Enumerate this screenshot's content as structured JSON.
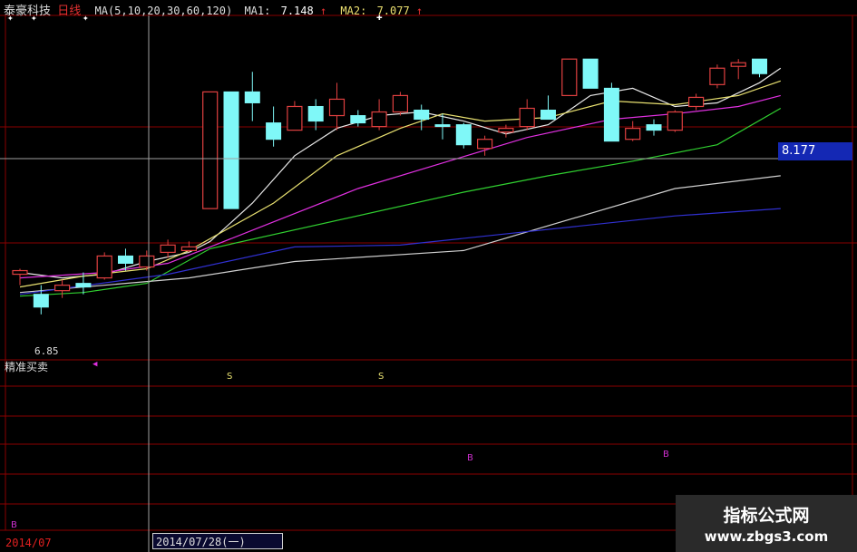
{
  "header": {
    "stock_name": "泰豪科技",
    "period": "日线",
    "ma_params": "MA(5,10,20,30,60,120)",
    "ma1_label": "MA1:",
    "ma1_value": "7.148",
    "ma1_arrow": "↑",
    "ma2_label": "MA2:",
    "ma2_value": "7.077",
    "ma2_arrow": "↑"
  },
  "current_price": "8.177",
  "low_price_label": "6.85",
  "indicator_panel": {
    "title": "精准买卖",
    "sell_label": "S",
    "buy_label": "B"
  },
  "footer": {
    "start_date": "2014/07",
    "cursor_date": "2014/07/28(一)"
  },
  "watermark": {
    "line1": "指标公式网",
    "line2": "www.zbgs3.com"
  },
  "colors": {
    "up_candle": "#e04040",
    "down_candle": "#7ff8f8",
    "ma5": "#e8e8e8",
    "ma10": "#e8e070",
    "ma20": "#e030e0",
    "ma30": "#30d030",
    "ma60": "#d0d0d0",
    "ma120": "#3030d0",
    "grid": "#8a0000"
  },
  "chart_data": {
    "type": "candlestick",
    "ylim": [
      6.7,
      8.4
    ],
    "candles": [
      {
        "o": 7.07,
        "h": 7.1,
        "l": 7.01,
        "c": 7.09
      },
      {
        "o": 6.96,
        "h": 7.01,
        "l": 6.85,
        "c": 6.89
      },
      {
        "o": 6.98,
        "h": 7.04,
        "l": 6.94,
        "c": 7.01
      },
      {
        "o": 7.02,
        "h": 7.08,
        "l": 6.96,
        "c": 7.0
      },
      {
        "o": 7.05,
        "h": 7.19,
        "l": 7.04,
        "c": 7.17
      },
      {
        "o": 7.17,
        "h": 7.21,
        "l": 7.09,
        "c": 7.13
      },
      {
        "o": 7.11,
        "h": 7.2,
        "l": 7.09,
        "c": 7.17
      },
      {
        "o": 7.19,
        "h": 7.26,
        "l": 7.16,
        "c": 7.23
      },
      {
        "o": 7.2,
        "h": 7.25,
        "l": 7.19,
        "c": 7.22
      },
      {
        "o": 7.43,
        "h": 8.07,
        "l": 7.43,
        "c": 8.07
      },
      {
        "o": 8.07,
        "h": 8.07,
        "l": 7.43,
        "c": 7.43
      },
      {
        "o": 8.07,
        "h": 8.18,
        "l": 7.91,
        "c": 8.01
      },
      {
        "o": 7.9,
        "h": 7.99,
        "l": 7.77,
        "c": 7.81
      },
      {
        "o": 7.86,
        "h": 8.02,
        "l": 7.86,
        "c": 7.99
      },
      {
        "o": 7.99,
        "h": 8.03,
        "l": 7.86,
        "c": 7.91
      },
      {
        "o": 7.94,
        "h": 8.12,
        "l": 7.86,
        "c": 8.03
      },
      {
        "o": 7.94,
        "h": 7.97,
        "l": 7.88,
        "c": 7.9
      },
      {
        "o": 7.88,
        "h": 8.03,
        "l": 7.86,
        "c": 7.96
      },
      {
        "o": 7.96,
        "h": 8.07,
        "l": 7.94,
        "c": 8.05
      },
      {
        "o": 7.97,
        "h": 8.0,
        "l": 7.86,
        "c": 7.92
      },
      {
        "o": 7.89,
        "h": 7.95,
        "l": 7.81,
        "c": 7.88
      },
      {
        "o": 7.89,
        "h": 7.9,
        "l": 7.76,
        "c": 7.78
      },
      {
        "o": 7.76,
        "h": 7.83,
        "l": 7.72,
        "c": 7.81
      },
      {
        "o": 7.85,
        "h": 7.89,
        "l": 7.82,
        "c": 7.87
      },
      {
        "o": 7.88,
        "h": 8.03,
        "l": 7.86,
        "c": 7.98
      },
      {
        "o": 7.97,
        "h": 8.05,
        "l": 7.94,
        "c": 7.92
      },
      {
        "o": 8.05,
        "h": 8.25,
        "l": 8.05,
        "c": 8.25
      },
      {
        "o": 8.25,
        "h": 8.25,
        "l": 8.09,
        "c": 8.09
      },
      {
        "o": 8.09,
        "h": 8.12,
        "l": 7.8,
        "c": 7.8
      },
      {
        "o": 7.81,
        "h": 7.91,
        "l": 7.8,
        "c": 7.87
      },
      {
        "o": 7.89,
        "h": 7.92,
        "l": 7.83,
        "c": 7.86
      },
      {
        "o": 7.86,
        "h": 7.97,
        "l": 7.85,
        "c": 7.96
      },
      {
        "o": 7.99,
        "h": 8.06,
        "l": 7.97,
        "c": 8.04
      },
      {
        "o": 8.11,
        "h": 8.22,
        "l": 8.09,
        "c": 8.2
      },
      {
        "o": 8.21,
        "h": 8.25,
        "l": 8.14,
        "c": 8.23
      },
      {
        "o": 8.25,
        "h": 8.25,
        "l": 8.15,
        "c": 8.17
      }
    ],
    "ma_lines": [
      {
        "name": "MA5",
        "points": [
          [
            0,
            7.08
          ],
          [
            2,
            7.05
          ],
          [
            4,
            7.07
          ],
          [
            6,
            7.14
          ],
          [
            8,
            7.19
          ],
          [
            9,
            7.25
          ],
          [
            11,
            7.46
          ],
          [
            13,
            7.72
          ],
          [
            15,
            7.87
          ],
          [
            17,
            7.94
          ],
          [
            19,
            7.96
          ],
          [
            21,
            7.91
          ],
          [
            23,
            7.84
          ],
          [
            25,
            7.89
          ],
          [
            27,
            8.05
          ],
          [
            29,
            8.09
          ],
          [
            31,
            7.99
          ],
          [
            33,
            8.01
          ],
          [
            35,
            8.12
          ],
          [
            36,
            8.2
          ]
        ]
      },
      {
        "name": "MA10",
        "points": [
          [
            0,
            7.0
          ],
          [
            3,
            7.06
          ],
          [
            6,
            7.1
          ],
          [
            8,
            7.2
          ],
          [
            12,
            7.46
          ],
          [
            15,
            7.72
          ],
          [
            18,
            7.87
          ],
          [
            20,
            7.95
          ],
          [
            22,
            7.91
          ],
          [
            25,
            7.93
          ],
          [
            28,
            8.02
          ],
          [
            31,
            8.0
          ],
          [
            34,
            8.05
          ],
          [
            36,
            8.13
          ]
        ]
      },
      {
        "name": "MA20",
        "points": [
          [
            0,
            7.05
          ],
          [
            4,
            7.08
          ],
          [
            7,
            7.13
          ],
          [
            9,
            7.22
          ],
          [
            16,
            7.54
          ],
          [
            20,
            7.68
          ],
          [
            24,
            7.82
          ],
          [
            28,
            7.92
          ],
          [
            31,
            7.95
          ],
          [
            34,
            7.99
          ],
          [
            36,
            8.05
          ]
        ]
      },
      {
        "name": "MA30",
        "points": [
          [
            0,
            6.95
          ],
          [
            3,
            6.97
          ],
          [
            6,
            7.02
          ],
          [
            9,
            7.21
          ],
          [
            21,
            7.52
          ],
          [
            25,
            7.61
          ],
          [
            29,
            7.69
          ],
          [
            33,
            7.78
          ],
          [
            36,
            7.98
          ]
        ]
      },
      {
        "name": "MA60",
        "points": [
          [
            0,
            6.97
          ],
          [
            8,
            7.05
          ],
          [
            13,
            7.14
          ],
          [
            21,
            7.2
          ],
          [
            31,
            7.54
          ],
          [
            36,
            7.61
          ]
        ]
      },
      {
        "name": "MA120",
        "points": [
          [
            0,
            6.96
          ],
          [
            7,
            7.07
          ],
          [
            13,
            7.22
          ],
          [
            18,
            7.23
          ],
          [
            31,
            7.39
          ],
          [
            36,
            7.43
          ]
        ]
      }
    ],
    "sell_signals": [
      10,
      17
    ],
    "buy_signals": [
      22,
      31
    ]
  }
}
